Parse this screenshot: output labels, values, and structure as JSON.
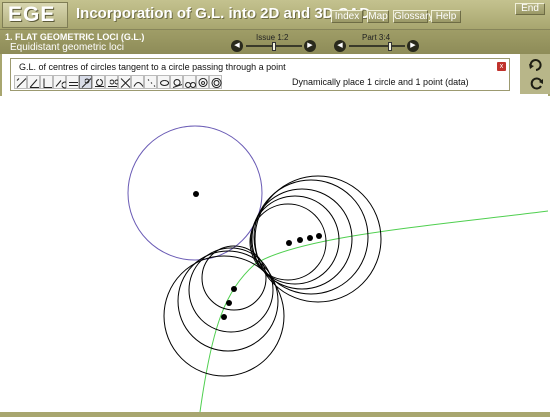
{
  "header": {
    "logo": "EGE",
    "title": "Incorporation of G.L. into 2D and 3D CAD",
    "nav": [
      "Index",
      "Map",
      "Glossary",
      "Help"
    ],
    "end_label": "End"
  },
  "section": {
    "title": "1. FLAT GEOMETRIC LOCI (G.L.)",
    "subtitle": "Equidistant geometric loci",
    "issue_label": "Issue 1:2",
    "part_label": "Part 3:4",
    "issue_progress": 0.5,
    "part_progress": 0.75
  },
  "exercise": {
    "title": "G.L. of centres of circles tangent to a circle passing through a point",
    "close_label": "x",
    "status": "Dynamically place 1 circle and 1 point (data)",
    "tools": [
      "distance-tool-icon",
      "angle-tool-icon",
      "perpendicular-tool-icon",
      "arc-tool-icon",
      "parallel-tool-icon",
      "tangent-tool-icon",
      "circle-point-tool-icon",
      "circles-tool-icon",
      "bisector-tool-icon",
      "curve-tool-icon",
      "points-tool-icon",
      "ellipse-tool-icon",
      "circle-tangent-tool-icon",
      "double-circle-tool-icon",
      "circle-circle-tool-icon",
      "concentric-tool-icon"
    ],
    "active_tool": 5
  },
  "colors": {
    "frame": "#a8a66f",
    "data_circle": "#6a5bb5",
    "locus": "#4fcf4f",
    "circles": "#000000"
  }
}
